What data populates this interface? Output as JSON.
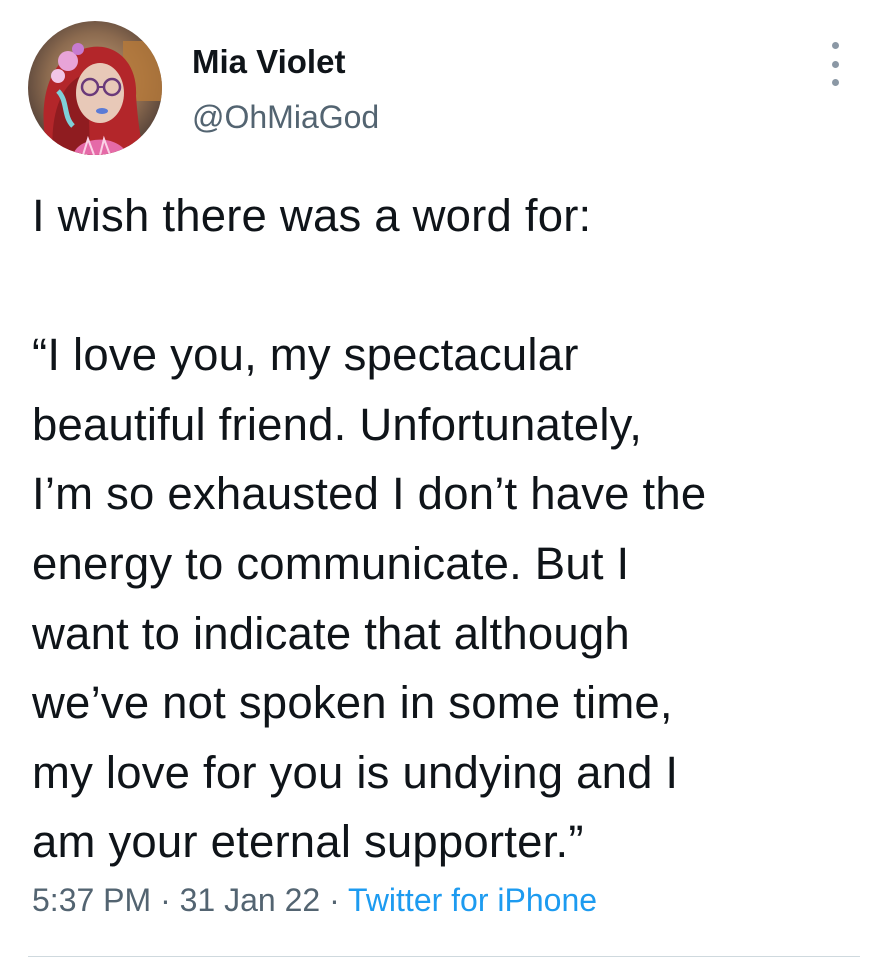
{
  "author": {
    "display_name": "Mia Violet",
    "handle": "@OhMiaGod"
  },
  "tweet": {
    "lines": [
      "I wish there was a word for:",
      "",
      "“I love you, my spectacular",
      "beautiful friend. Unfortunately,",
      "I’m so exhausted I don’t have the",
      "energy to communicate. But I",
      "want to indicate that although",
      "we’ve not spoken in some time,",
      "my love for you is undying and I",
      "am your eternal supporter.”"
    ]
  },
  "meta": {
    "time": "5:37 PM",
    "separator": " · ",
    "date": "31 Jan 22",
    "source": "Twitter for iPhone"
  },
  "icons": {
    "more": "more-vertical-icon"
  },
  "colors": {
    "text": "#0f1419",
    "secondary": "#536471",
    "link": "#1d9bf0"
  }
}
